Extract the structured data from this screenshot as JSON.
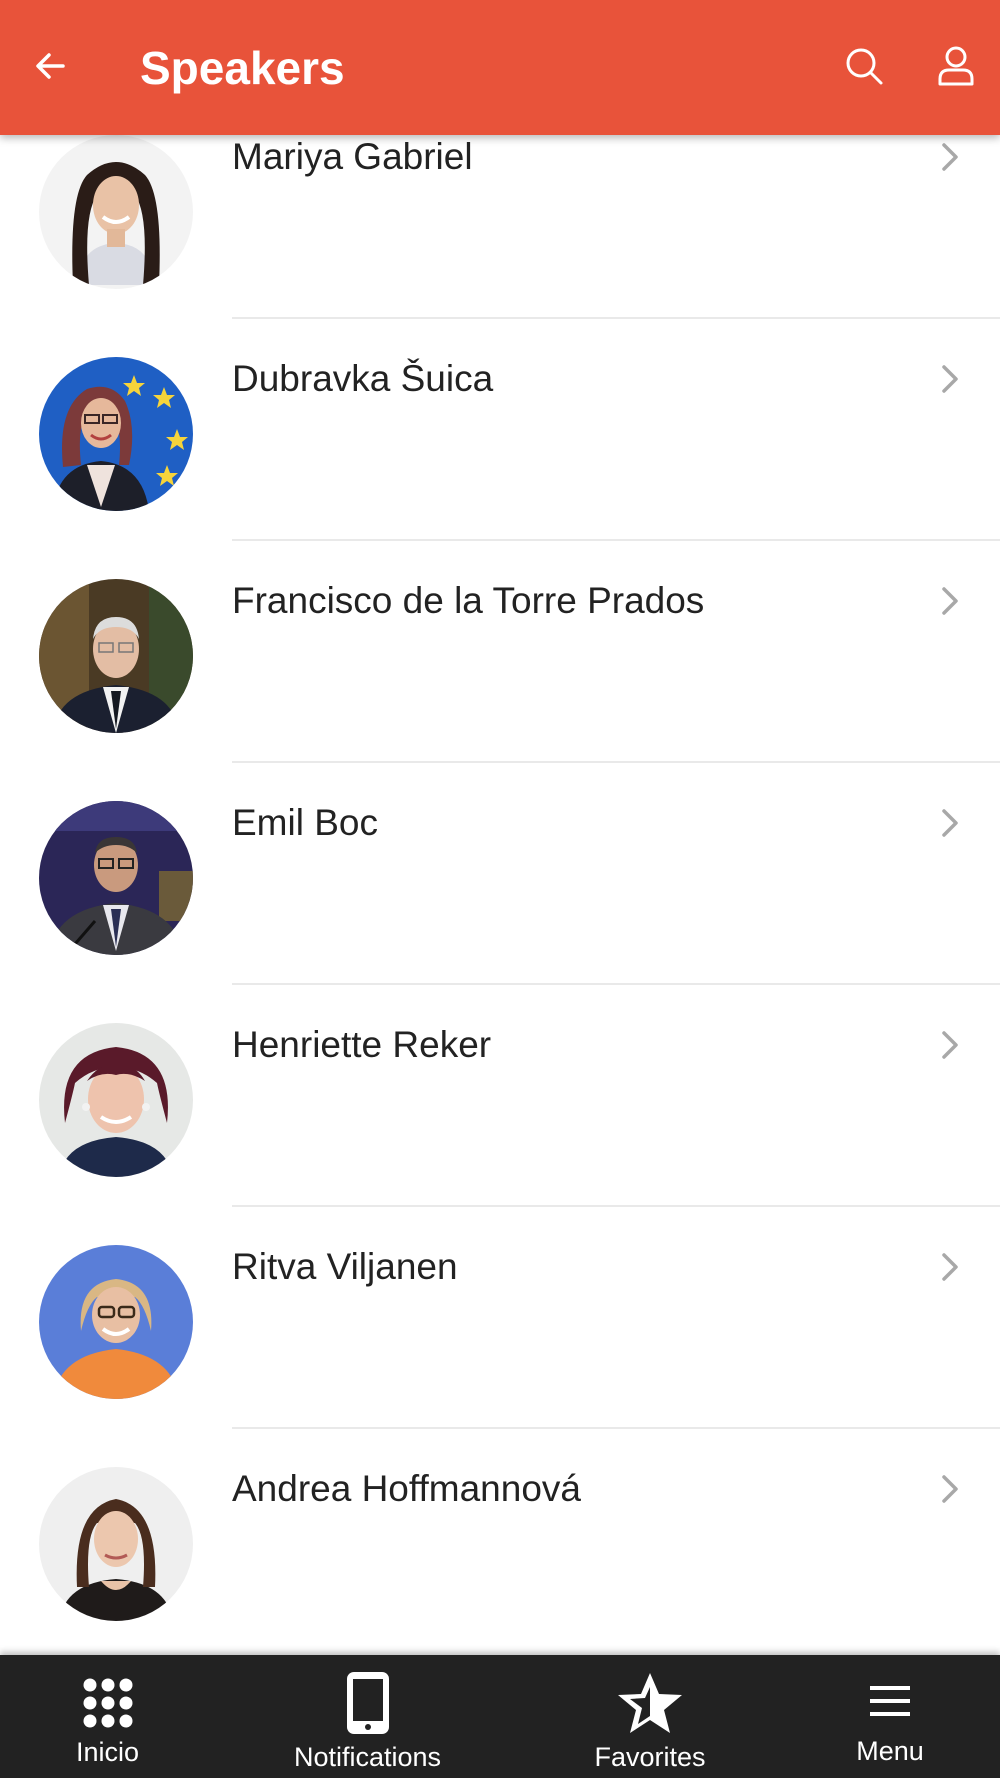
{
  "colors": {
    "header_bg": "#E8533A",
    "nav_bg": "#222222",
    "text": "#222222",
    "chevron": "#a8a8a8",
    "divider": "#e9e9e9"
  },
  "header": {
    "title": "Speakers",
    "back_icon": "arrow-left-icon",
    "search_icon": "search-icon",
    "profile_icon": "user-icon"
  },
  "speakers": [
    {
      "name": "Mariya Gabriel",
      "avatar": "photo"
    },
    {
      "name": "Dubravka Šuica",
      "avatar": "photo"
    },
    {
      "name": "Francisco de la Torre Prados",
      "avatar": "photo"
    },
    {
      "name": "Emil Boc",
      "avatar": "photo"
    },
    {
      "name": "Henriette Reker",
      "avatar": "photo"
    },
    {
      "name": "Ritva Viljanen",
      "avatar": "photo"
    },
    {
      "name": "Andrea Hoffmannová",
      "avatar": "photo"
    }
  ],
  "bottom_nav": {
    "items": [
      {
        "label": "Inicio",
        "icon": "grid-icon"
      },
      {
        "label": "Notifications",
        "icon": "phone-icon"
      },
      {
        "label": "Favorites",
        "icon": "star-icon"
      },
      {
        "label": "Menu",
        "icon": "hamburger-icon"
      }
    ]
  }
}
